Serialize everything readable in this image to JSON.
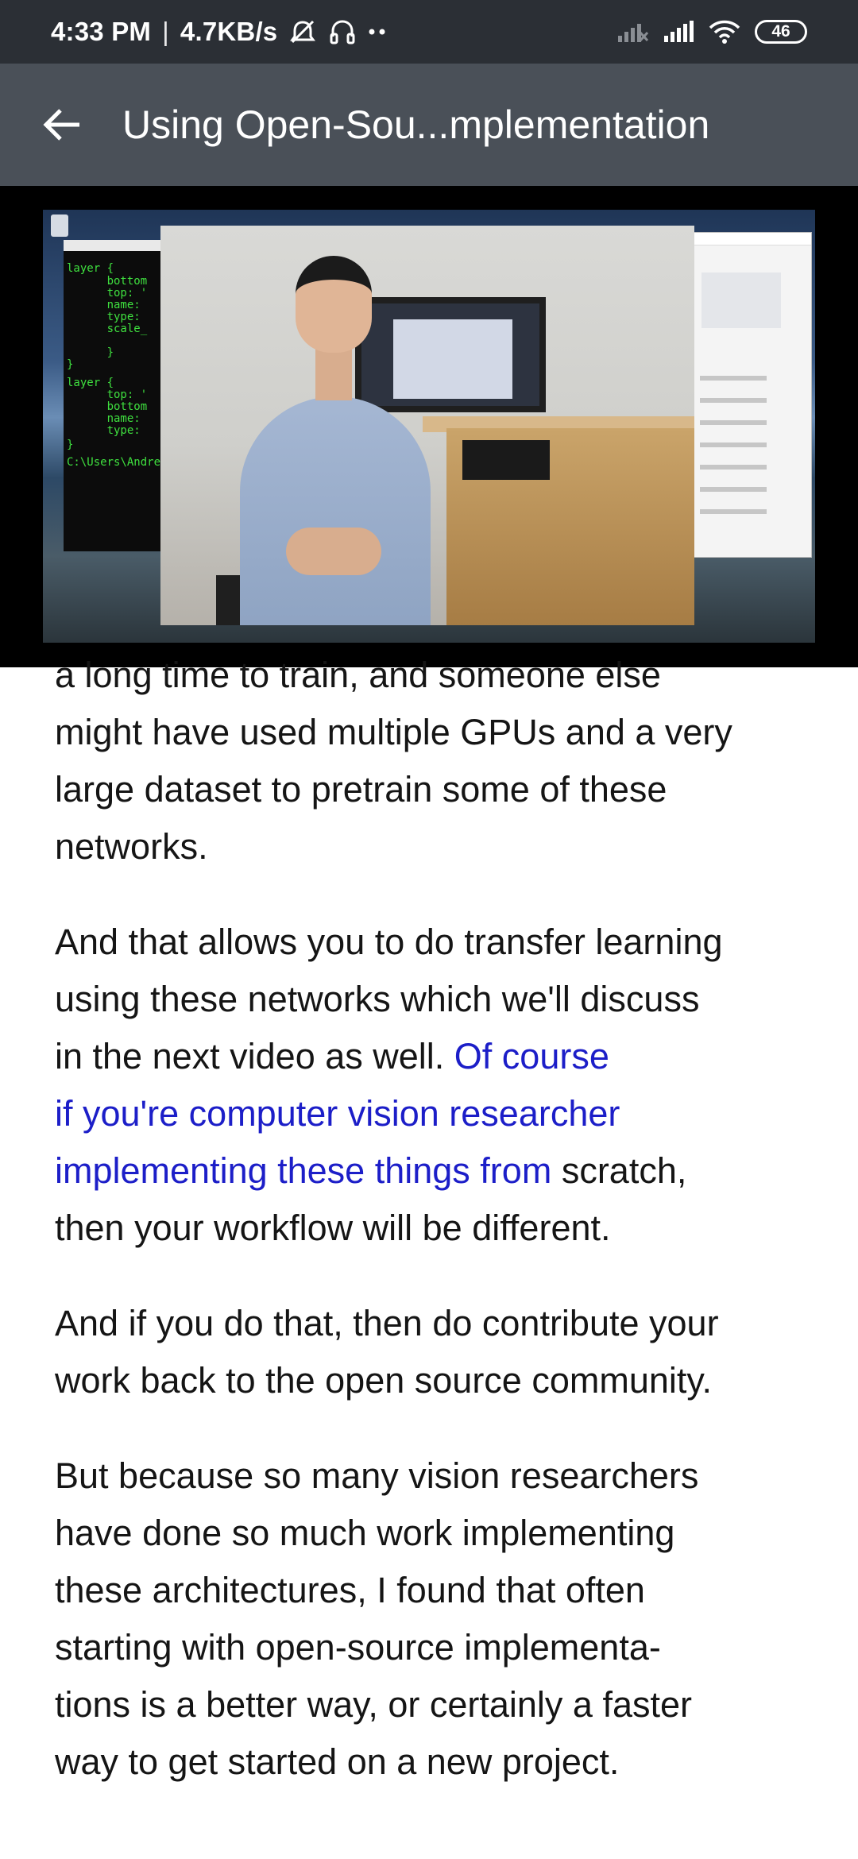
{
  "status_bar": {
    "time": "4:33 PM",
    "separator": "|",
    "net_speed": "4.7KB/s",
    "battery_level": "46",
    "icons": [
      "alarm-off-icon",
      "headset-icon",
      "more-dots-icon",
      "signal-weak-icon",
      "signal-icon",
      "wifi-icon",
      "battery-icon"
    ]
  },
  "app_bar": {
    "title": "Using Open-Sou...mplementation",
    "back_icon": "arrow-back-icon"
  },
  "video": {
    "code_lines": [
      "layer {",
      "      bottom",
      "      top: '",
      "      name:",
      "      type:",
      "      scale_",
      "      }",
      "}",
      "layer {",
      "      top: '",
      "      bottom",
      "      name:",
      "      type:",
      "}",
      "C:\\Users\\Andre"
    ]
  },
  "transcript": {
    "p1": [
      "a long time to train, and someone else",
      "might have used multiple GPUs and a very",
      "large dataset to pretrain some of these",
      "networks."
    ],
    "p2_line1": "And that allows you to do transfer learning",
    "p2_line2": "using these networks which we'll discuss",
    "p2_line3_plain": "in the next video as well. ",
    "p2_line3_hl": "Of course",
    "p2_line4_hl": "if you're computer vision researcher",
    "p2_line5_hl": "implementing these things from",
    "p2_line5_plain": " scratch,",
    "p2_line6": "then your workflow will be different.",
    "p3": [
      "And if you do that, then do contribute your",
      "work back to the open source community."
    ],
    "p4": [
      "But because so many vision researchers",
      "have done so much work implementing",
      "these architectures, I found that often",
      "starting with open-source implementa-",
      "tions is a better way, or certainly a faster",
      "way to get started on a new project."
    ],
    "highlight_color": "#1c1ec8"
  }
}
